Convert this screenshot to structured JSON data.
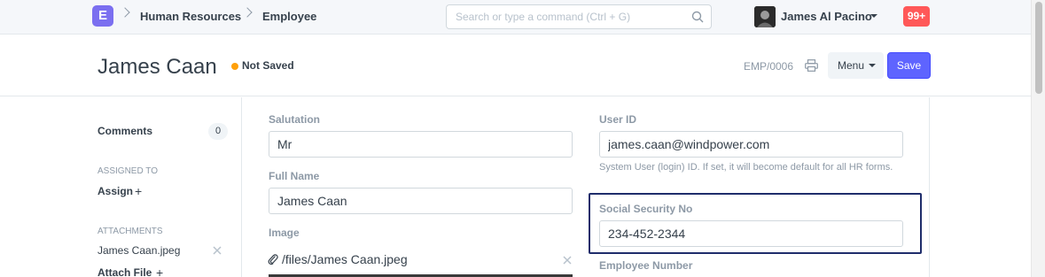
{
  "navbar": {
    "logo_letter": "E",
    "breadcrumbs": [
      "Human Resources",
      "Employee"
    ],
    "search_placeholder": "Search or type a command (Ctrl + G)",
    "user_name": "James Al Pacino",
    "notifications": "99+"
  },
  "page_head": {
    "title": "James Caan",
    "status": "Not Saved",
    "doc_name": "EMP/0006",
    "menu_label": "Menu",
    "save_label": "Save"
  },
  "sidebar": {
    "comments_label": "Comments",
    "comments_count": "0",
    "assigned_to_label": "Assigned To",
    "assign_label": "Assign",
    "attachments_label": "Attachments",
    "attachment_file": "James Caan.jpeg",
    "attach_file_label": "Attach File"
  },
  "form": {
    "salutation": {
      "label": "Salutation",
      "value": "Mr"
    },
    "full_name": {
      "label": "Full Name",
      "value": "James Caan"
    },
    "image": {
      "label": "Image",
      "value": "/files/James Caan.jpeg"
    },
    "user_id": {
      "label": "User ID",
      "value": "james.caan@windpower.com",
      "help": "System User (login) ID. If set, it will become default for all HR forms."
    },
    "social_security_no": {
      "label": "Social Security No",
      "value": "234-452-2344"
    },
    "employee_number": {
      "label": "Employee Number"
    }
  },
  "colors": {
    "primary": "#5e64ff",
    "logo": "#7b6ff0",
    "notification": "#ff5858",
    "status_dot": "#ffa00a",
    "highlight": "#1f2d6b"
  }
}
